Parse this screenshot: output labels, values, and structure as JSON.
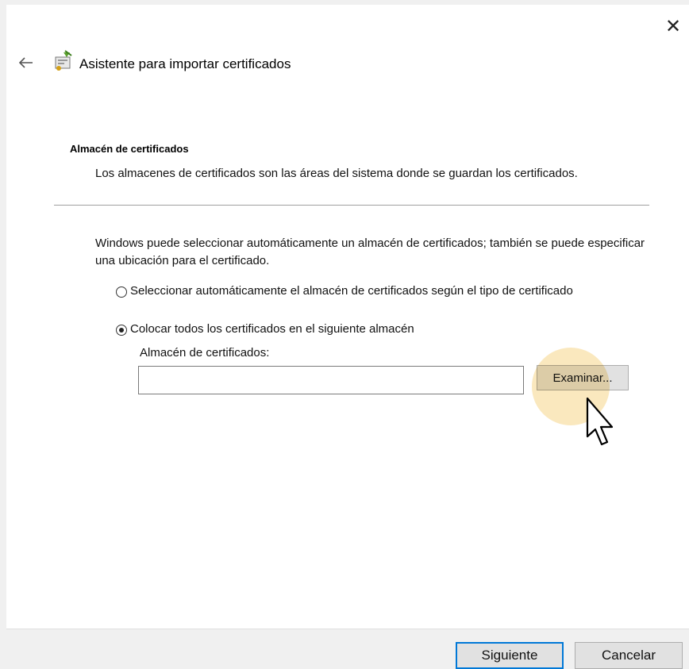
{
  "window": {
    "close_glyph": "✕",
    "back_glyph": "←"
  },
  "wizard": {
    "title": "Asistente para importar certificados",
    "icon": "certificate-wizard-icon"
  },
  "section": {
    "title": "Almacén de certificados",
    "description": "Los almacenes de certificados son las áreas del sistema donde se guardan los certificados."
  },
  "main": {
    "intro": "Windows puede seleccionar automáticamente un almacén de certificados; también se puede especificar una ubicación para el certificado.",
    "options": [
      {
        "label": "Seleccionar automáticamente el almacén de certificados según el tipo de certificado",
        "selected": false
      },
      {
        "label": "Colocar todos los certificados en el siguiente almacén",
        "selected": true
      }
    ],
    "store_label": "Almacén de certificados:",
    "store_value": "",
    "browse_label": "Examinar..."
  },
  "footer": {
    "next_label": "Siguiente",
    "cancel_label": "Cancelar"
  },
  "colors": {
    "primary_border": "#0078d7",
    "highlight": "#f7dc9b"
  }
}
